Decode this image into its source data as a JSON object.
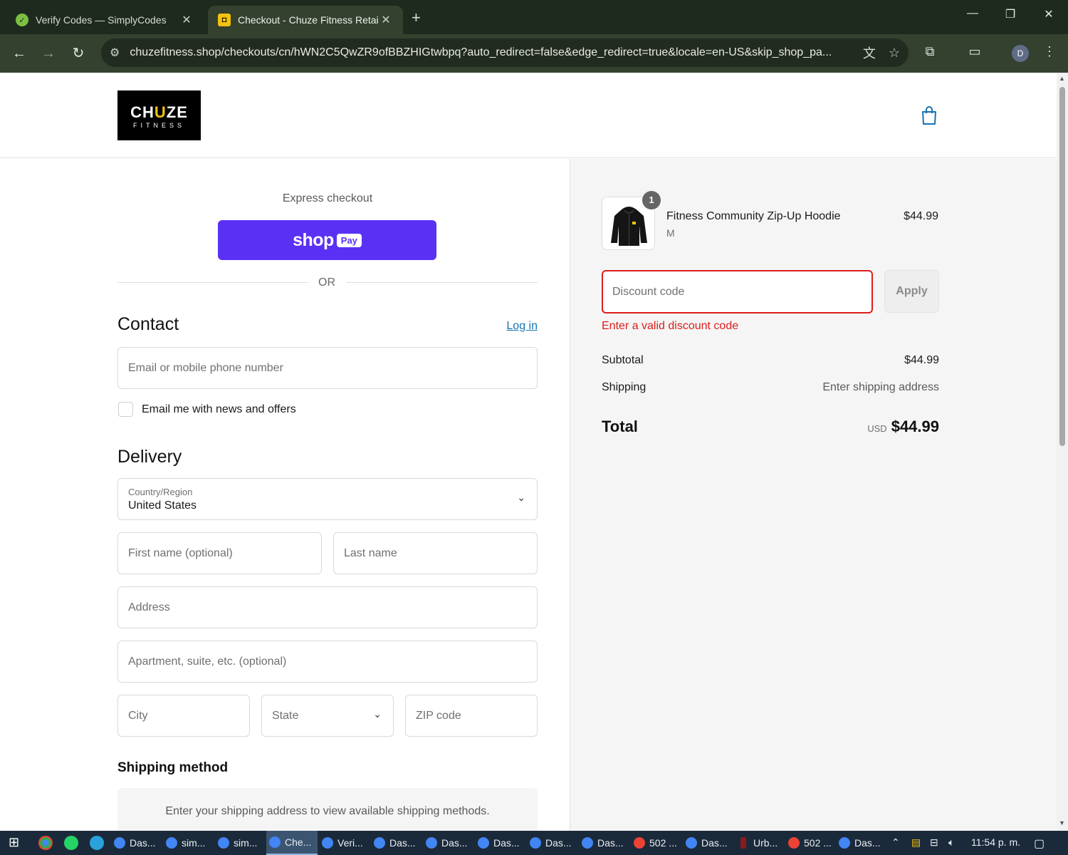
{
  "browser": {
    "tabs": [
      {
        "title": "Verify Codes — SimplyCodes",
        "icon": "simplycodes-icon"
      },
      {
        "title": "Checkout - Chuze Fitness Retail",
        "icon": "chuze-icon"
      }
    ],
    "new_tab": "+",
    "window_controls": {
      "minimize": "—",
      "restore": "❐",
      "close": "✕"
    },
    "url": "chuzefitness.shop/checkouts/cn/hWN2C5QwZR9ofBBZHIGtwbpq?auto_redirect=false&edge_redirect=true&locale=en-US&skip_shop_pa...",
    "profile_initial": "D"
  },
  "header": {
    "logo_line1_a": "CH",
    "logo_line1_u": "U",
    "logo_line1_b": "ZE",
    "logo_line2": "FITNESS"
  },
  "express": {
    "label": "Express checkout",
    "shop_label": "shop",
    "pay_label": "Pay",
    "or_label": "OR"
  },
  "contact": {
    "heading": "Contact",
    "login": "Log in",
    "email_placeholder": "Email or mobile phone number",
    "newsletter_label": "Email me with news and offers"
  },
  "delivery": {
    "heading": "Delivery",
    "country_label": "Country/Region",
    "country_value": "United States",
    "first_name": "First name (optional)",
    "last_name": "Last name",
    "address": "Address",
    "apartment": "Apartment, suite, etc. (optional)",
    "city": "City",
    "state": "State",
    "zip": "ZIP code"
  },
  "shipping_method": {
    "heading": "Shipping method",
    "info": "Enter your shipping address to view available shipping methods."
  },
  "order": {
    "quantity": "1",
    "product_name": "Fitness Community Zip-Up Hoodie",
    "variant": "M",
    "price": "$44.99",
    "discount_placeholder": "Discount code",
    "apply": "Apply",
    "discount_error": "Enter a valid discount code",
    "subtotal_label": "Subtotal",
    "subtotal_value": "$44.99",
    "shipping_label": "Shipping",
    "shipping_value": "Enter shipping address",
    "total_label": "Total",
    "currency": "USD",
    "total_value": "$44.99"
  },
  "taskbar": {
    "items": [
      "Das...",
      "sim...",
      "sim...",
      "Che...",
      "Veri...",
      "Das...",
      "Das...",
      "Das...",
      "Das...",
      "Das...",
      "502 ...",
      "Das...",
      "Urb...",
      "502 ...",
      "Das..."
    ],
    "time": "11:54 p. m."
  },
  "colors": {
    "shop_pay": "#5a31f4",
    "error": "#dd1d1d",
    "link": "#1773b0",
    "logo_accent": "#f4c20d"
  }
}
